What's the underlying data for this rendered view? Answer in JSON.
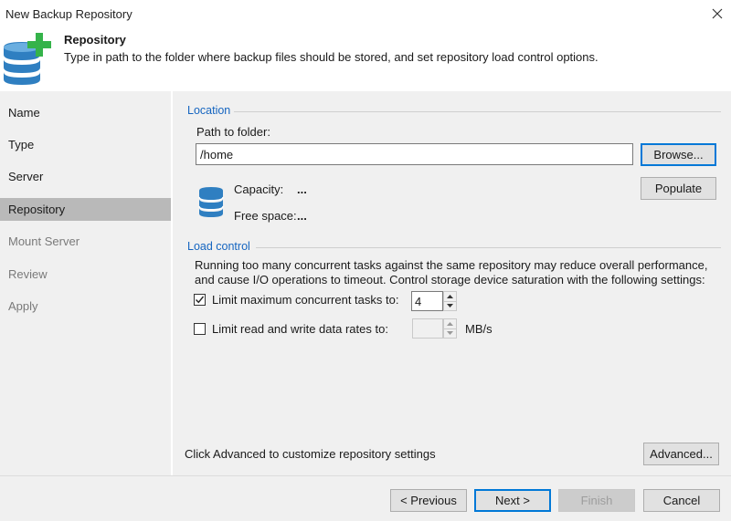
{
  "window": {
    "title": "New Backup Repository",
    "close_label": "×"
  },
  "header": {
    "title": "Repository",
    "description": "Type in path to the folder where backup files should be stored, and set repository load control options."
  },
  "sidebar": {
    "items": [
      {
        "label": "Name",
        "state": "normal"
      },
      {
        "label": "Type",
        "state": "normal"
      },
      {
        "label": "Server",
        "state": "normal"
      },
      {
        "label": "Repository",
        "state": "active"
      },
      {
        "label": "Mount Server",
        "state": "disabled"
      },
      {
        "label": "Review",
        "state": "disabled"
      },
      {
        "label": "Apply",
        "state": "disabled"
      }
    ]
  },
  "location": {
    "section_title": "Location",
    "path_label": "Path to folder:",
    "path_value": "/home",
    "browse_label": "Browse...",
    "populate_label": "Populate",
    "capacity_label": "Capacity:",
    "capacity_value": "...",
    "free_space_label": "Free space:",
    "free_space_value": "..."
  },
  "load_control": {
    "section_title": "Load control",
    "description_line1": "Running too many concurrent tasks against the same repository may reduce overall performance,",
    "description_line2": "and cause I/O operations to timeout. Control storage device saturation with the following settings:",
    "limit_tasks_label": "Limit maximum concurrent tasks to:",
    "limit_tasks_checked": true,
    "limit_tasks_value": "4",
    "limit_rate_label": "Limit read and write data rates to:",
    "limit_rate_checked": false,
    "limit_rate_value": "",
    "rate_unit": "MB/s"
  },
  "advanced": {
    "hint": "Click Advanced to customize repository settings",
    "button_label": "Advanced..."
  },
  "footer": {
    "previous_label": "< Previous",
    "next_label": "Next >",
    "finish_label": "Finish",
    "cancel_label": "Cancel"
  },
  "colors": {
    "accent": "#1565c0",
    "icon_blue": "#2f7fc1",
    "icon_green": "#35b34a",
    "sidebar_active": "#b9b9b9",
    "panel_bg": "#f0f0f0"
  },
  "icons": {
    "close": "close-icon",
    "header": "database-add-icon",
    "storage": "database-icon",
    "checkmark": "checkmark-icon",
    "spin_up": "arrow-up-icon",
    "spin_down": "arrow-down-icon"
  }
}
